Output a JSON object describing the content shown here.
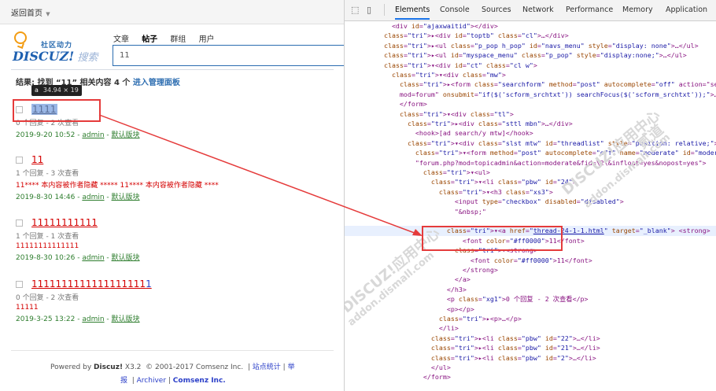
{
  "left": {
    "home_link": "返回首页",
    "logo": {
      "cn": "社区动力",
      "word": "DISCUZ!",
      "sub": "搜索"
    },
    "search_tabs": [
      {
        "label": "文章",
        "active": false
      },
      {
        "label": "帖子",
        "active": true
      },
      {
        "label": "群组",
        "active": false
      },
      {
        "label": "用户",
        "active": false
      }
    ],
    "search_value": "11",
    "result": {
      "prefix": "结果: 找到 “11” 相关内容 4 个",
      "link": "进入管理面板"
    },
    "tooltip": {
      "tag": "a",
      "dims": "34.94 × 19"
    },
    "items": [
      {
        "title": "1111",
        "blue": "",
        "meta": "0 个回复 - 2 次查看",
        "body": "",
        "date": "2019-9-20 10:52",
        "author": "admin",
        "forum": "默认版块"
      },
      {
        "title": "11",
        "blue": "",
        "meta": "1 个回复 - 3 次查看",
        "body": "11**** 本内容被作者隐藏 ***** 11**** 本内容被作者隐藏 ****",
        "date": "2019-8-30 14:46",
        "author": "admin",
        "forum": "默认版块"
      },
      {
        "title": "11111111111",
        "blue": "",
        "meta": "1 个回复 - 1 次查看",
        "body": "11111111111111",
        "date": "2019-8-30 10:26",
        "author": "admin",
        "forum": "默认版块"
      },
      {
        "title": "1111111111111111111",
        "blue": "1",
        "meta": "0 个回复 - 2 次查看",
        "body": "11111",
        "date": "2019-3-25 13:22",
        "author": "admin",
        "forum": "默认版块"
      }
    ],
    "footer": {
      "line1_a": "Powered by",
      "line1_b": "Discuz!",
      "line1_c": "X3.2",
      "line1_d": "© 2001-2017 Comsenz Inc.",
      "line1_e": "站点统计",
      "line1_f": "举",
      "line2_a": "报",
      "line2_b": "Archiver",
      "line2_c": "Comsenz Inc."
    }
  },
  "devtools": {
    "tabs": [
      "Elements",
      "Console",
      "Sources",
      "Network",
      "Performance",
      "Memory",
      "Application"
    ],
    "active_tab": "Elements"
  },
  "dom_rows": [
    "            <div id=\"ajaxwaitid\"></div>",
    "          ▸<div id=\"toptb\" class=\"cl\">…</div>",
    "          ▸<ul class=\"p_pop h_pop\" id=\"navs_menu\" style=\"display: none\">…</ul>",
    "          ▸<ul id=\"myspace_menu\" class=\"p_pop\" style=\"display:none;\">…</ul>",
    "          ▾<div id=\"ct\" class=\"cl w\">",
    "            ▾<div class=\"mw\">",
    "              ▸<form class=\"searchform\" method=\"post\" autocomplete=\"off\" action=\"search.php?",
    "              mod=forum\" onsubmit=\"if($('scform_srchtxt')) searchFocus($('scform_srchtxt'));\">…",
    "              </form>",
    "              ▾<div class=\"tl\">",
    "                ▸<div class=\"sttl mbn\">…</div>",
    "                  <hook>[ad search/y mtw]</hook>",
    "                ▾<div class=\"slst mtw\" id=\"threadlist\" style=\"position: relative;\">",
    "                  ▾<form method=\"post\" autocomplete=\"off\" name=\"moderate\" id=\"moderate\" action=",
    "                  \"forum.php?mod=topicadmin&action=moderate&fid=\\2\\&infloat=yes&nopost=yes\">",
    "                    ▾<ul>",
    "                      ▾<li class=\"pbw\" id=\"24\">",
    "                        ▾<h3 class=\"xs3\">",
    "                            <input type=\"checkbox\" disabled=\"disabled\">",
    "                            \"&nbsp;\"",
    "",
    "                          ▾<a href=\"thread-24-1-1.html\" target=\"_blank\"> <strong>",
    "                              <font color=\"#ff0000\">11</font>",
    "                            ▾<strong>",
    "                                <font color=\"#ff0000\">11</font>",
    "                              </strong>",
    "                            </a>",
    "                          </h3>",
    "                          <p class=\"xg1\">0 个回复 - 2 次查看</p>",
    "                          <p></p>",
    "                        ▸<p>…</p>",
    "                        </li>",
    "                      ▸<li class=\"pbw\" id=\"22\">…</li>",
    "                      ▸<li class=\"pbw\" id=\"21\">…</li>",
    "                      ▸<li class=\"pbw\" id=\"2\">…</li>",
    "                      </ul>",
    "                    </form>"
  ],
  "selected_row": 21,
  "watermarks": [
    "DISCUZ!应用中心",
    "addon.dismall.com",
    "贰道"
  ]
}
